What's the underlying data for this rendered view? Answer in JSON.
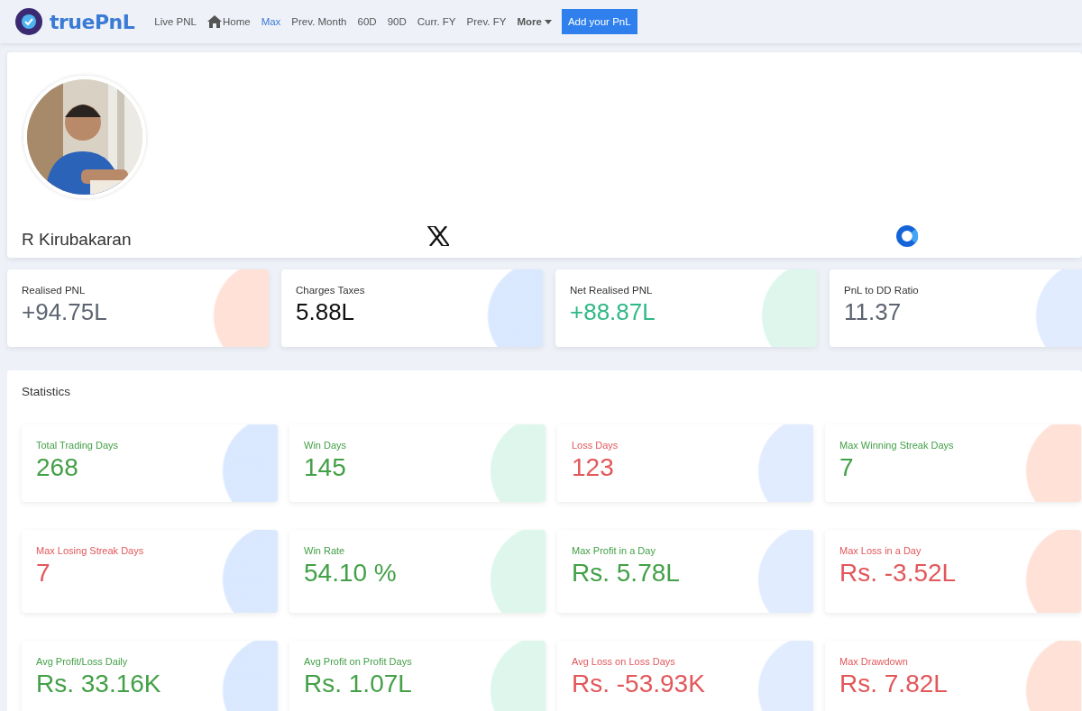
{
  "navbar": {
    "brand": "truePnL",
    "items": [
      {
        "kind": "link",
        "label": "Live PNL",
        "selected": false
      },
      {
        "kind": "home",
        "label": "Home",
        "selected": false
      },
      {
        "kind": "link",
        "label": "Max",
        "selected": true
      },
      {
        "kind": "link",
        "label": "Prev. Month",
        "selected": false
      },
      {
        "kind": "link",
        "label": "60D",
        "selected": false
      },
      {
        "kind": "link",
        "label": "90D",
        "selected": false
      },
      {
        "kind": "link",
        "label": "Curr. FY",
        "selected": false
      },
      {
        "kind": "link",
        "label": "Prev. FY",
        "selected": false
      },
      {
        "kind": "dropdown",
        "label": "More",
        "selected": false
      }
    ],
    "button": {
      "label": "Add your PnL"
    }
  },
  "profile": {
    "name": "R Kirubakaran"
  },
  "summary": [
    {
      "label": "Realised PNL",
      "value": "+94.75L",
      "color": "#5d6470"
    },
    {
      "label": "Charges Taxes",
      "value": "5.88L",
      "color": "#111111"
    },
    {
      "label": "Net Realised PNL",
      "value": "+88.87L",
      "color": "#2eb886"
    },
    {
      "label": "PnL to DD Ratio",
      "value": "11.37",
      "color": "#5d6470"
    }
  ],
  "statistics": {
    "title": "Statistics",
    "cards": [
      {
        "label": "Total Trading Days",
        "value": "268",
        "color": "#43a047"
      },
      {
        "label": "Win Days",
        "value": "145",
        "color": "#43a047"
      },
      {
        "label": "Loss Days",
        "value": "123",
        "color": "#e2575a"
      },
      {
        "label": "Max Winning Streak Days",
        "value": "7",
        "color": "#43a047"
      },
      {
        "label": "Max Losing Streak Days",
        "value": "7",
        "color": "#e2575a"
      },
      {
        "label": "Win Rate",
        "value": "54.10 %",
        "color": "#43a047"
      },
      {
        "label": "Max Profit in a Day",
        "value": "Rs. 5.78L",
        "color": "#43a047"
      },
      {
        "label": "Max Loss in a Day",
        "value": "Rs. -3.52L",
        "color": "#e2575a"
      },
      {
        "label": "Avg Profit/Loss Daily",
        "value": "Rs. 33.16K",
        "color": "#43a047"
      },
      {
        "label": "Avg Profit on Profit Days",
        "value": "Rs. 1.07L",
        "color": "#43a047"
      },
      {
        "label": "Avg Loss on Loss Days",
        "value": "Rs. -53.93K",
        "color": "#e2575a"
      },
      {
        "label": "Max Drawdown",
        "value": "Rs. 7.82L",
        "color": "#e2575a"
      }
    ]
  }
}
